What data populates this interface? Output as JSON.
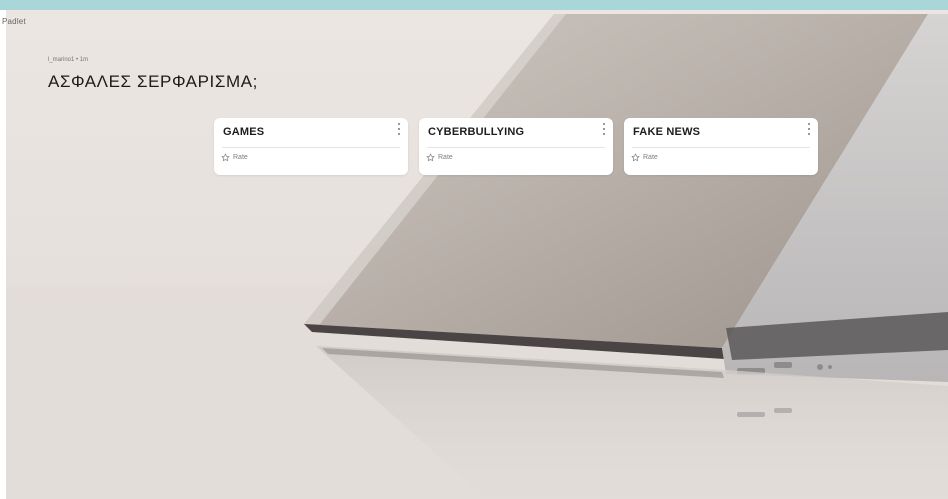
{
  "brand": "Padlet",
  "header": {
    "author_meta": "l_marino1 • 1m",
    "title": "ΑΣΦΑΛΕΣ ΣΕΡΦΑΡΙΣΜΑ;"
  },
  "posts": [
    {
      "title": "GAMES",
      "rate_label": "Rate"
    },
    {
      "title": "CYBERBULLYING",
      "rate_label": "Rate"
    },
    {
      "title": "FAKE NEWS",
      "rate_label": "Rate"
    }
  ],
  "icons": {
    "menu": "more-vertical-icon",
    "rate": "star-outline-icon"
  },
  "colors": {
    "top_strip": "#a9d6d8",
    "card": "#ffffff",
    "title_text": "#1f1b1a"
  }
}
